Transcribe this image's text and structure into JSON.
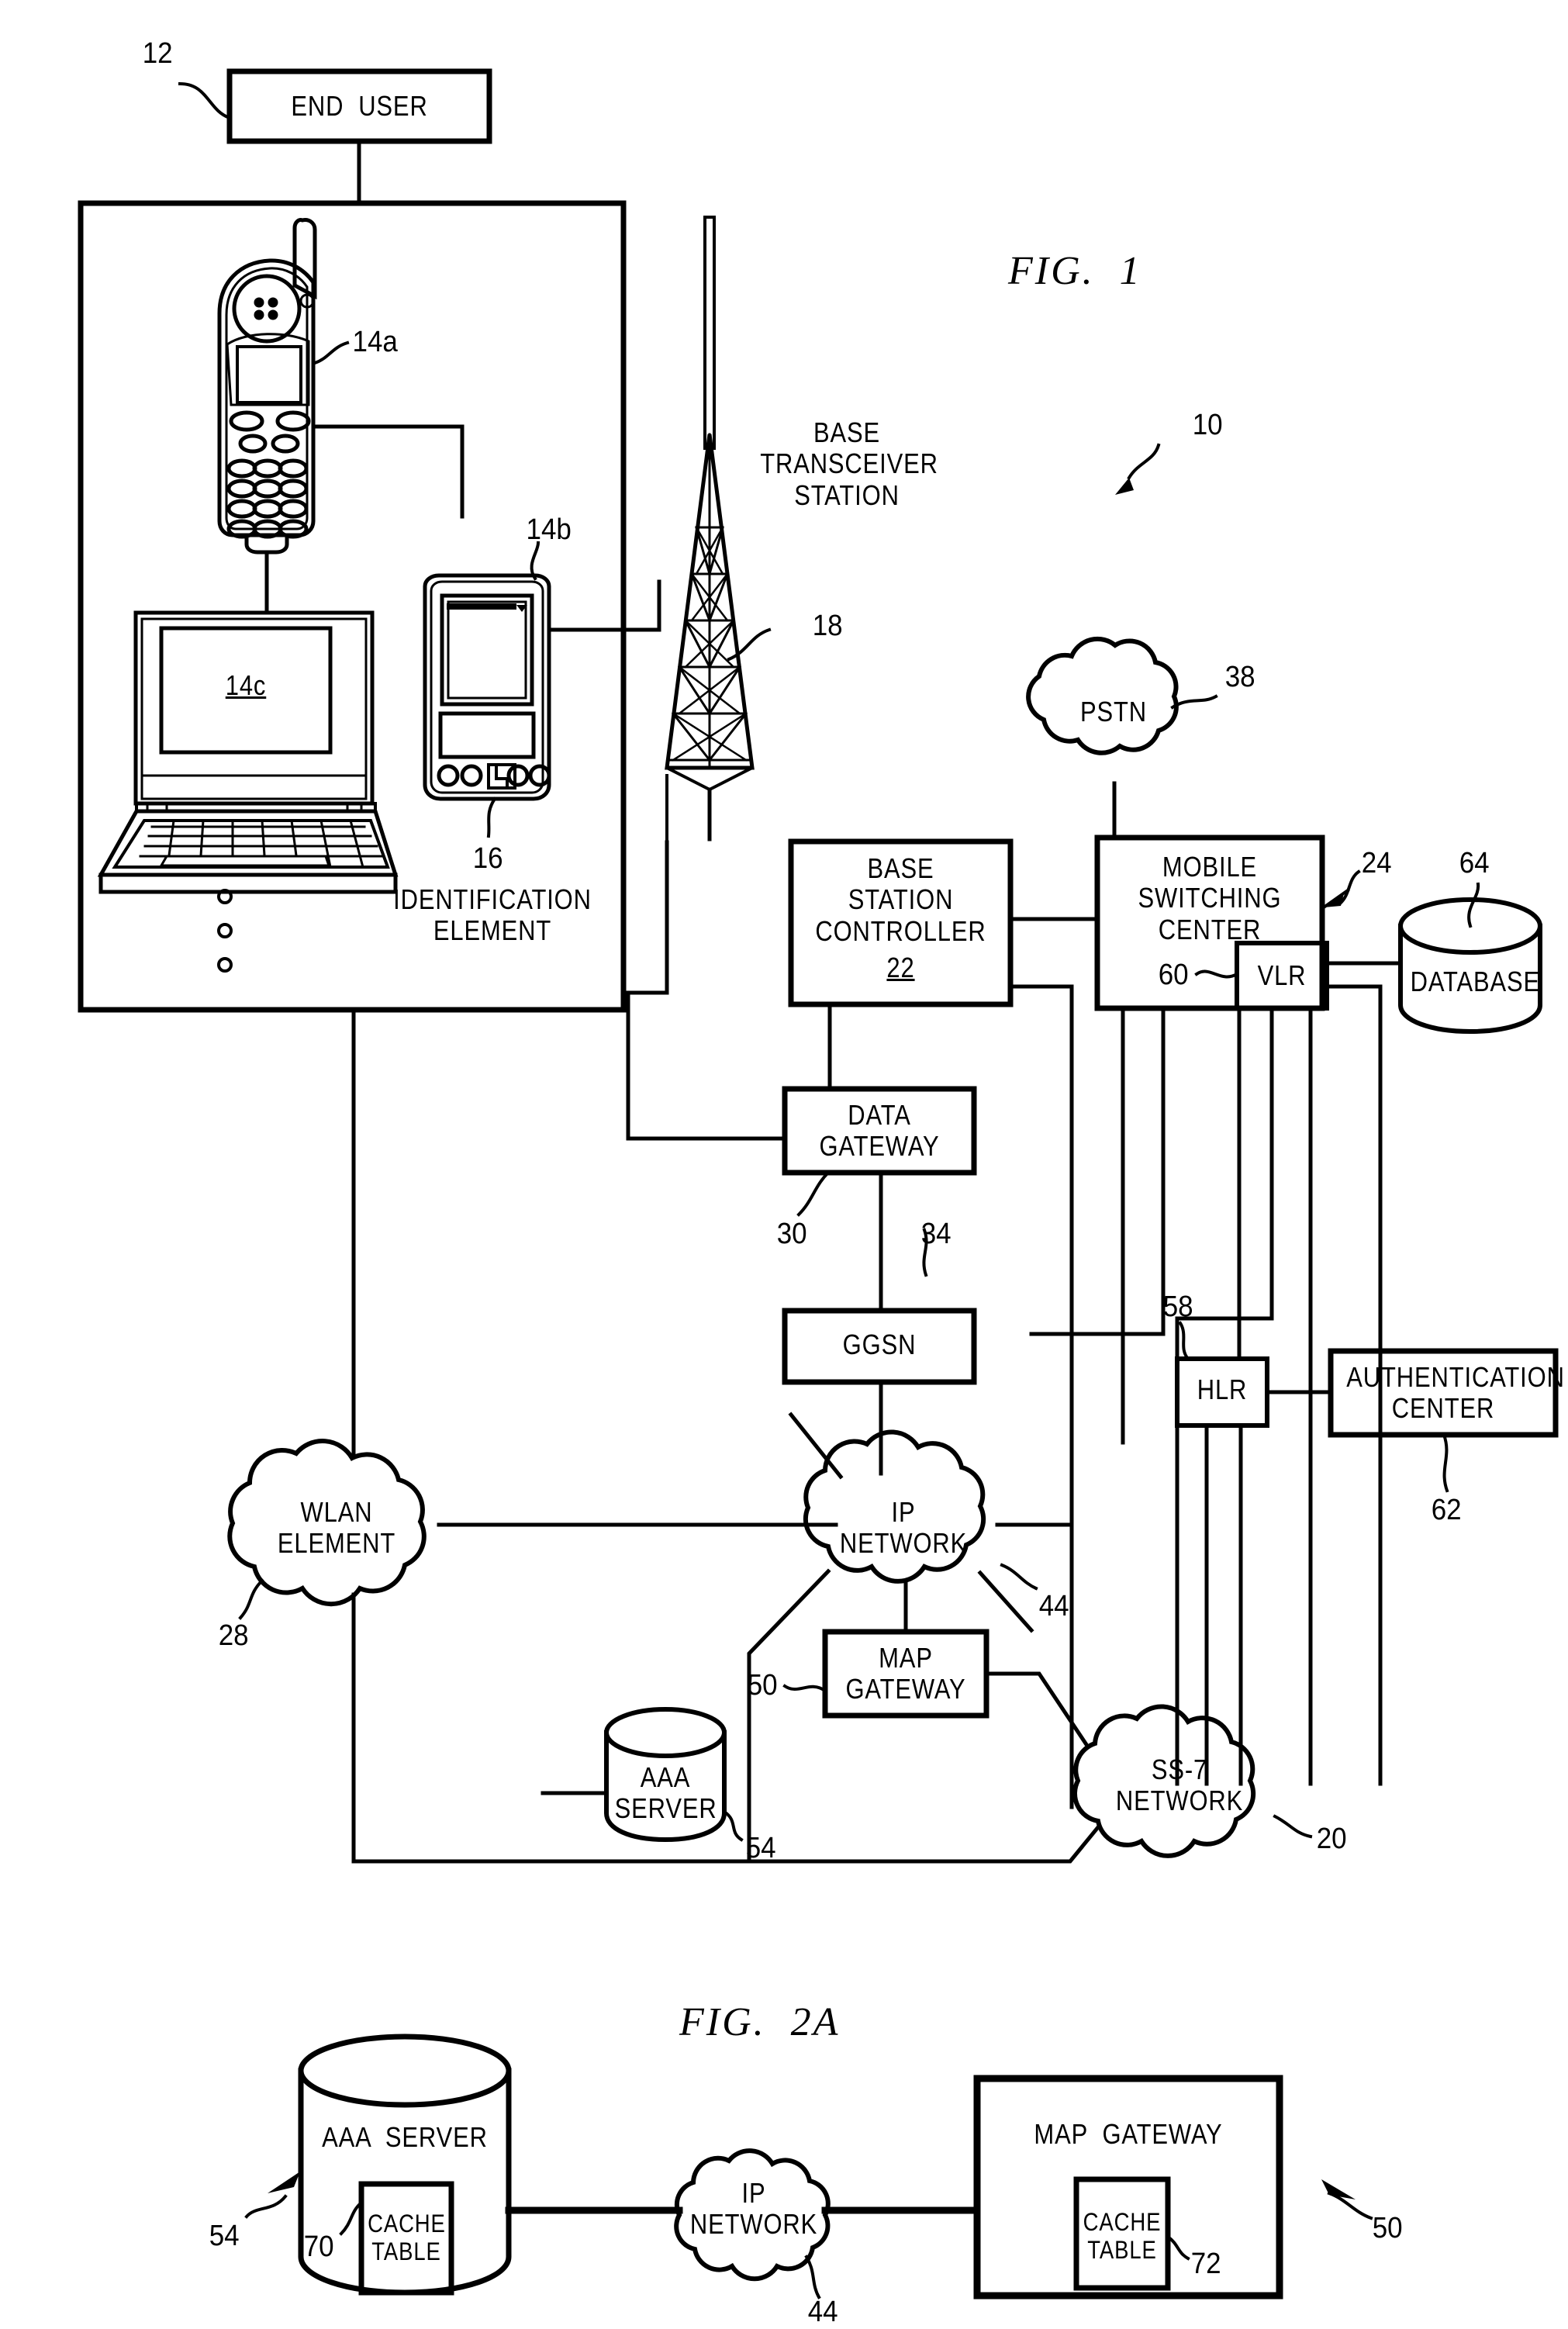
{
  "figures": {
    "fig1": {
      "title": "FIG.  1",
      "system_ref": "10"
    },
    "fig2a": {
      "title": "FIG.  2A"
    }
  },
  "fig1": {
    "end_user": {
      "label": "END  USER",
      "ref": "12"
    },
    "devices": {
      "phone": {
        "ref": "14a",
        "name": "mobile-phone"
      },
      "pda": {
        "ref": "14b",
        "name": "pda-device"
      },
      "laptop": {
        "ref": "14c",
        "screen_label": "14c",
        "name": "laptop-device"
      },
      "identification_element": {
        "ref": "16",
        "label": "IDENTIFICATION\nELEMENT"
      },
      "ellipsis": "○\n○\n○"
    },
    "base_transceiver_station": {
      "label": "BASE\nTRANSCEIVER\nSTATION",
      "ref": "18"
    },
    "base_station_controller": {
      "label": "BASE\nSTATION\nCONTROLLER",
      "ref": "22"
    },
    "mobile_switching_center": {
      "label": "MOBILE\nSWITCHING\nCENTER",
      "ref": "24"
    },
    "vlr": {
      "label": "VLR",
      "ref": "60"
    },
    "database": {
      "label": "DATABASE",
      "ref": "64"
    },
    "pstn": {
      "label": "PSTN",
      "ref": "38"
    },
    "data_gateway": {
      "label": "DATA\nGATEWAY",
      "ref": "30"
    },
    "ggsn": {
      "label": "GGSN",
      "ref": "34"
    },
    "hlr": {
      "label": "HLR",
      "ref": "58"
    },
    "authentication_center": {
      "label": "AUTHENTICATION\nCENTER",
      "ref": "62"
    },
    "wlan_element": {
      "label": "WLAN\nELEMENT",
      "ref": "28"
    },
    "ip_network": {
      "label": "IP\nNETWORK",
      "ref": "44"
    },
    "map_gateway": {
      "label": "MAP\nGATEWAY",
      "ref": "50"
    },
    "aaa_server": {
      "label": "AAA\nSERVER",
      "ref": "54"
    },
    "ss7_network": {
      "label": "SS-7\nNETWORK",
      "ref": "20"
    }
  },
  "fig2a": {
    "aaa_server": {
      "label": "AAA  SERVER",
      "ref": "54"
    },
    "aaa_cache_table": {
      "label": "CACHE\nTABLE",
      "ref": "70"
    },
    "ip_network": {
      "label": "IP\nNETWORK",
      "ref": "44"
    },
    "map_gateway": {
      "label": "MAP  GATEWAY",
      "ref": "50"
    },
    "map_cache_table": {
      "label": "CACHE\nTABLE",
      "ref": "72"
    }
  },
  "colors": {
    "ink": "#000000",
    "paper": "#ffffff"
  }
}
